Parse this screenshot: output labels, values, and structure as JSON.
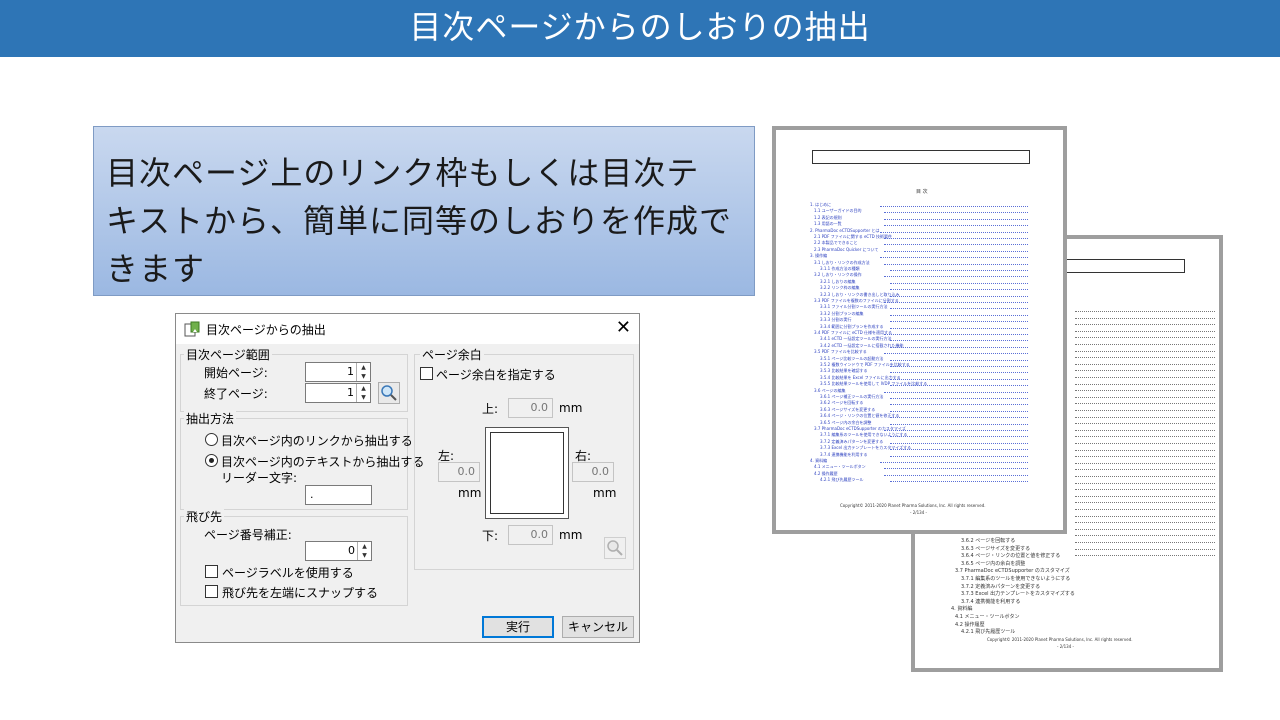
{
  "slide": {
    "title": "目次ページからのしおりの抽出",
    "callout_lines": [
      "目次ページ上のリンク枠もしくは目次テ",
      "キストから、簡単に同等のしおりを作成で",
      "きます"
    ]
  },
  "dialog": {
    "title": "目次ページからの抽出",
    "range_group": "目次ページ範囲",
    "start_label": "開始ページ:",
    "start_value": "1",
    "end_label": "終了ページ:",
    "end_value": "1",
    "method_group": "抽出方法",
    "radio_link": "目次ページ内のリンクから抽出する",
    "radio_text": "目次ページ内のテキストから抽出する",
    "leader_label": "リーダー文字:",
    "leader_value": ".",
    "jump_group": "飛び先",
    "offset_label": "ページ番号補正:",
    "offset_value": "0",
    "use_page_label": "ページラベルを使用する",
    "snap_left": "飛び先を左端にスナップする",
    "margin_group": "ページ余白",
    "margin_check": "ページ余白を指定する",
    "top_label": "上:",
    "top_value": "0.0",
    "left_label": "左:",
    "left_value": "0.0",
    "right_label": "右:",
    "right_value": "0.0",
    "bottom_label": "下:",
    "bottom_value": "0.0",
    "unit": "mm",
    "run_button": "実行",
    "cancel_button": "キャンセル"
  },
  "doc_front": {
    "toc_heading": "目 次",
    "footer": "Copyright© 2011-2020 Planet Pharma Solutions, Inc. All rights reserved.",
    "page": "- 2/134 -",
    "toc": [
      "1. はじめに",
      "1.1 ユーザーガイドの目的",
      "1.2 表記の規則",
      "1.3 用語の一覧",
      "2. PharmaDoc eCTDSupporter とは",
      "2.1 PDF ファイルに関する eCTD 技術要件",
      "2.2 本製品でできること",
      "2.3 PharmaDoc Quicker について",
      "3. 操作編",
      "3.1 しおり・リンクの作成方法",
      "3.1.1 作成方法の種類",
      "3.2 しおり・リンクの操作",
      "3.2.1 しおりの編集",
      "3.2.2 リンク枠の編集",
      "3.2.3 しおり・リンクの書き出しと取り込み",
      "3.3 PDF ファイルを複数のファイルに分割する",
      "3.3.1 ファイル分割ツールの実行方法",
      "3.3.2 分割プランの編集",
      "3.3.3 分割の実行",
      "3.3.4 範囲に分割プランを作成する",
      "3.4 PDF ファイルに eCTD 仕様を適用する",
      "3.4.1 eCTD 一括設定ツールの実行方法",
      "3.4.2 eCTD 一括設定ツールに搭載された機能",
      "3.5 PDF ファイルを比較する",
      "3.5.1 ページ比較ツールの起動方法",
      "3.5.2 複数ウインドウで PDF ファイルを比較する",
      "3.5.3 比較結果を確認する",
      "3.5.4 比較結果を Excel ファイルに出力する",
      "3.5.5 比較結果ツールを使用して IVDP ファイルを比較する",
      "3.6 ページの編集",
      "3.6.1 ページ補正ツールの実行方法",
      "3.6.2 ページを回転する",
      "3.6.3 ページサイズを変更する",
      "3.6.4 ページ・リンクの位置と値を修正する",
      "3.6.5 ページ内の余白を調整",
      "3.7 PharmaDoc eCTDSupporter のカスタマイズ",
      "3.7.1 編集系のツールを使用できないようにする",
      "3.7.2 定義済みパターンを変更する",
      "3.7.3 Excel 出力テンプレートをカスタマイズする",
      "3.7.4 連携機能を利用する",
      "4. 資料編",
      "4.1 メニュー・ツールボタン",
      "4.2 操作履歴",
      "4.2.1 飛び先履歴ツール"
    ]
  },
  "doc_back": {
    "footer": "Copyright© 2011-2020 Planet Pharma Solutions, Inc. All rights reserved.",
    "page": "- 2/134 -",
    "toc_visible": [
      "3.6.2 ページを回転する",
      "3.6.3 ページサイズを変更する",
      "3.6.4 ページ・リンクの位置と値を修正する",
      "3.6.5 ページ内の余白を調整",
      "3.7 PharmaDoc eCTDSupporter のカスタマイズ",
      "3.7.1 編集系のツールを使用できないようにする",
      "3.7.2 定義済みパターンを変更する",
      "3.7.3 Excel 出力テンプレートをカスタマイズする",
      "3.7.4 連携機能を利用する",
      "4. 資料編",
      "4.1 メニュー・ツールボタン",
      "4.2 操作履歴",
      "4.2.1 飛び先履歴ツール"
    ]
  },
  "colors": {
    "title_bar": "#2e75b6",
    "link_blue": "#2b3fbf",
    "accent": "#0078d7"
  }
}
